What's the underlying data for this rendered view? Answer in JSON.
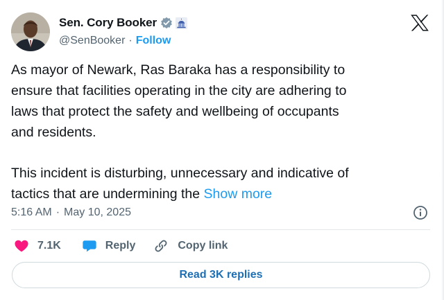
{
  "author": {
    "name": "Sen. Cory Booker",
    "handle": "@SenBooker",
    "follow_label": "Follow",
    "avatar_icon": "avatar-portrait",
    "verified_icon": "verified-badge-icon",
    "affiliation_icon": "capitol-building-icon"
  },
  "tweet": {
    "lines_para1": [
      "As mayor of Newark, Ras Baraka has a responsibility to",
      "ensure that facilities operating in the city are adhering to",
      "laws that protect the safety and wellbeing of occupants",
      "and residents."
    ],
    "line_para2_1": "This incident is disturbing, unnecessary and indicative of",
    "line_para2_2": "tactics that are undermining the",
    "show_more": "Show more"
  },
  "meta": {
    "time": "5:16 AM",
    "separator": "·",
    "date": "May 10, 2025"
  },
  "actions": {
    "like_count": "7.1K",
    "reply_label": "Reply",
    "copy_link_label": "Copy link"
  },
  "read_replies_label": "Read 3K replies",
  "colors": {
    "accent": "#1d9bf0",
    "like": "#f91880",
    "text_secondary": "#536471",
    "border": "#cfd9de"
  }
}
